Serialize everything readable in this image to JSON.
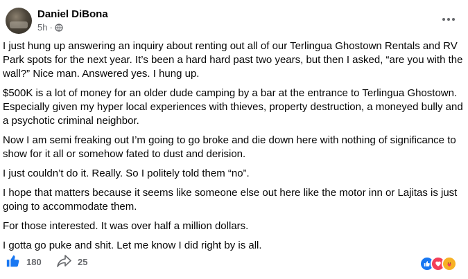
{
  "post": {
    "author": "Daniel DiBona",
    "time": "5h",
    "separator": "·",
    "paragraphs": [
      "I just hung up answering an inquiry about renting out all of our Terlingua Ghostown Rentals and RV Park spots for the next year.  It’s been a hard hard past two years, but then I asked, “are you with the wall?”  Nice man. Answered yes.  I hung up.",
      "$500K is a lot of money for an older dude camping by a bar at the entrance to Terlingua Ghostown. Especially  given my hyper local experiences with thieves, property destruction, a moneyed bully and a psychotic criminal neighbor.",
      "Now I am semi freaking out I’m going to go broke and die down here with nothing of significance to show for it all or somehow fated to dust and derision.",
      "I just couldn’t do it. Really. So I politely told them “no”.",
      "I hope that matters because it seems like someone else out here like the motor inn or Lajitas is just going to accommodate them.",
      "For those interested. It was over half a million dollars.",
      "I gotta go puke and shit.  Let me know I did right by is all."
    ],
    "like_count": "180",
    "share_count": "25"
  },
  "icons": {
    "privacy": "globe-icon",
    "more": "more-options-icon",
    "like": "thumbs-up-icon",
    "share": "share-arrow-icon",
    "reactions": [
      "like-reaction-icon",
      "love-reaction-icon",
      "care-reaction-icon"
    ]
  },
  "colors": {
    "accent": "#1877f2",
    "secondary_text": "#65676b",
    "love": "#f33e58",
    "care": "#f7b125"
  }
}
